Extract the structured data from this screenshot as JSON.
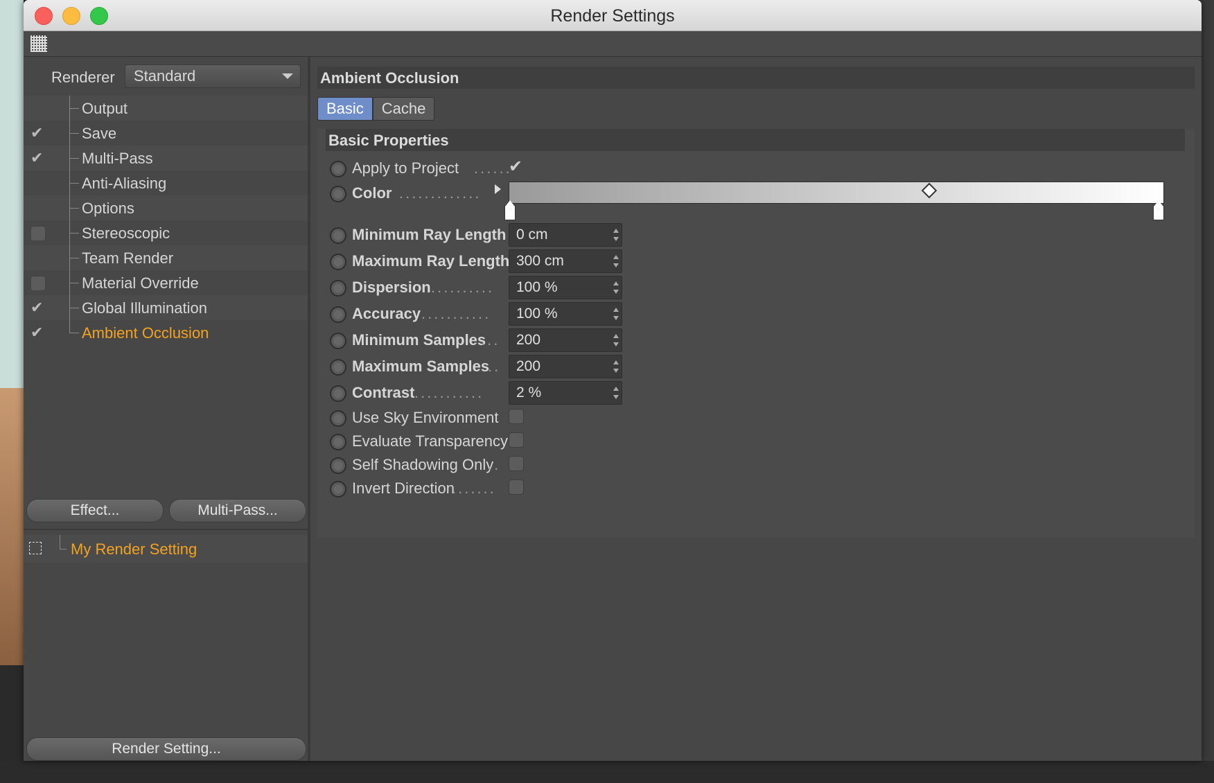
{
  "window": {
    "title": "Render Settings"
  },
  "renderer": {
    "label": "Renderer",
    "value": "Standard"
  },
  "tree": [
    {
      "label": "Output",
      "check": "none"
    },
    {
      "label": "Save",
      "check": "checked"
    },
    {
      "label": "Multi-Pass",
      "check": "checked"
    },
    {
      "label": "Anti-Aliasing",
      "check": "none"
    },
    {
      "label": "Options",
      "check": "none"
    },
    {
      "label": "Stereoscopic",
      "check": "box"
    },
    {
      "label": "Team Render",
      "check": "none"
    },
    {
      "label": "Material Override",
      "check": "box"
    },
    {
      "label": "Global Illumination",
      "check": "checked"
    },
    {
      "label": "Ambient Occlusion",
      "check": "checked"
    }
  ],
  "buttons": {
    "effect": "Effect...",
    "multipass": "Multi-Pass...",
    "render_setting": "Render Setting..."
  },
  "render_setting_name": "My Render Setting",
  "panel": {
    "title": "Ambient Occlusion",
    "tabs": [
      "Basic",
      "Cache"
    ],
    "group_title": "Basic Properties",
    "apply_label": "Apply to Project",
    "color_label": "Color",
    "fields": [
      {
        "label": "Minimum Ray Length",
        "value": "0 cm"
      },
      {
        "label": "Maximum Ray Length",
        "value": "300 cm"
      },
      {
        "label": "Dispersion",
        "value": "100 %"
      },
      {
        "label": "Accuracy",
        "value": "100 %"
      },
      {
        "label": "Minimum Samples",
        "value": "200"
      },
      {
        "label": "Maximum Samples",
        "value": "200"
      },
      {
        "label": "Contrast",
        "value": "2 %"
      }
    ],
    "checks": [
      {
        "label": "Use Sky Environment"
      },
      {
        "label": "Evaluate Transparency"
      },
      {
        "label": "Self Shadowing Only"
      },
      {
        "label": "Invert Direction"
      }
    ]
  },
  "colors": {
    "accent": "#f4a21f",
    "tab_active": "#6f8ec9"
  }
}
